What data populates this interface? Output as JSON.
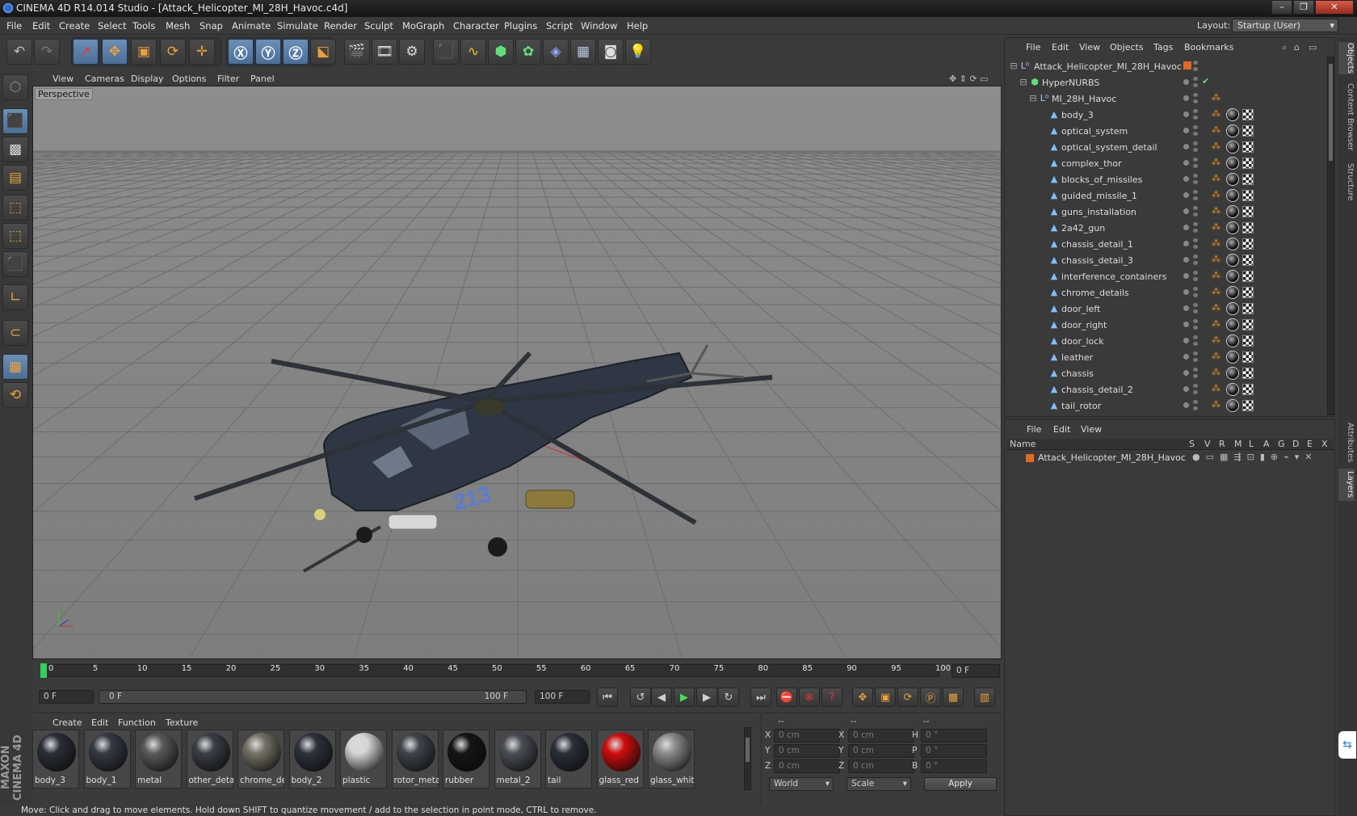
{
  "window": {
    "title": "CINEMA 4D R14.014 Studio - [Attack_Helicopter_MI_28H_Havoc.c4d]"
  },
  "menu": [
    "File",
    "Edit",
    "Create",
    "Select",
    "Tools",
    "Mesh",
    "Snap",
    "Animate",
    "Simulate",
    "Render",
    "Sculpt",
    "MoGraph",
    "Character",
    "Plugins",
    "Script",
    "Window",
    "Help"
  ],
  "layout": {
    "label": "Layout:",
    "value": "Startup (User)"
  },
  "viewport": {
    "menu": [
      "View",
      "Cameras",
      "Display",
      "Options",
      "Filter",
      "Panel"
    ],
    "label": "Perspective",
    "heli_number": "213"
  },
  "timeline": {
    "ticks": [
      "0",
      "5",
      "10",
      "15",
      "20",
      "25",
      "30",
      "35",
      "40",
      "45",
      "50",
      "55",
      "60",
      "65",
      "70",
      "75",
      "80",
      "85",
      "90",
      "95",
      "100"
    ],
    "frame_field": "0 F"
  },
  "transport": {
    "start": "0 F",
    "range_start": "0 F",
    "range_end": "100 F",
    "end": "100 F"
  },
  "materials": {
    "menu": [
      "Create",
      "Edit",
      "Function",
      "Texture"
    ],
    "items": [
      {
        "label": "body_3",
        "color": "#2a2e36"
      },
      {
        "label": "body_1",
        "color": "#353a44"
      },
      {
        "label": "metal",
        "color": "#5a5a5a"
      },
      {
        "label": "other_deta",
        "color": "#3a3e46"
      },
      {
        "label": "chrome_de",
        "color": "#777266"
      },
      {
        "label": "body_2",
        "color": "#2d323c"
      },
      {
        "label": "plastic",
        "color": "#d6d6d6"
      },
      {
        "label": "rotor_meta",
        "color": "#3f444c"
      },
      {
        "label": "rubber",
        "color": "#151515"
      },
      {
        "label": "metal_2",
        "color": "#4a4e55"
      },
      {
        "label": "tail",
        "color": "#2a2f38"
      },
      {
        "label": "glass_red",
        "color": "#d00c0c"
      },
      {
        "label": "glass_whit",
        "color": "#8c8c8c"
      }
    ]
  },
  "coords": {
    "header": [
      "--",
      "--",
      "--"
    ],
    "rows": [
      {
        "a": "X",
        "av": "0 cm",
        "b": "X",
        "bv": "0 cm",
        "c": "H",
        "cv": "0 °"
      },
      {
        "a": "Y",
        "av": "0 cm",
        "b": "Y",
        "bv": "0 cm",
        "c": "P",
        "cv": "0 °"
      },
      {
        "a": "Z",
        "av": "0 cm",
        "b": "Z",
        "bv": "0 cm",
        "c": "B",
        "cv": "0 °"
      }
    ],
    "world": "World",
    "scale": "Scale",
    "apply": "Apply"
  },
  "objects": {
    "menu": [
      "File",
      "Edit",
      "View",
      "Objects",
      "Tags",
      "Bookmarks"
    ],
    "root": "Attack_Helicopter_MI_28H_Havoc",
    "hypernurbs": "HyperNURBS",
    "group": "MI_28H_Havoc",
    "children": [
      "body_3",
      "optical_system",
      "optical_system_detail",
      "complex_thor",
      "blocks_of_missiles",
      "guided_missile_1",
      "guns_installation",
      "2a42_gun",
      "chassis_detail_1",
      "chassis_detail_3",
      "interference_containers",
      "chrome_details",
      "door_left",
      "door_right",
      "door_lock",
      "leather",
      "chassis",
      "chassis_detail_2",
      "tail_rotor"
    ]
  },
  "layers": {
    "menu": [
      "File",
      "Edit",
      "View"
    ],
    "columns": [
      "Name",
      "S",
      "V",
      "R",
      "M",
      "L",
      "A",
      "G",
      "D",
      "E",
      "X"
    ],
    "row": "Attack_Helicopter_MI_28H_Havoc"
  },
  "side_tabs": [
    "Objects",
    "Content Browser",
    "Structure",
    "Attributes",
    "Layers"
  ],
  "status": "Move: Click and drag to move elements. Hold down SHIFT to quantize movement / add to the selection in point mode, CTRL to remove.",
  "brand": "MAXON CINEMA 4D"
}
